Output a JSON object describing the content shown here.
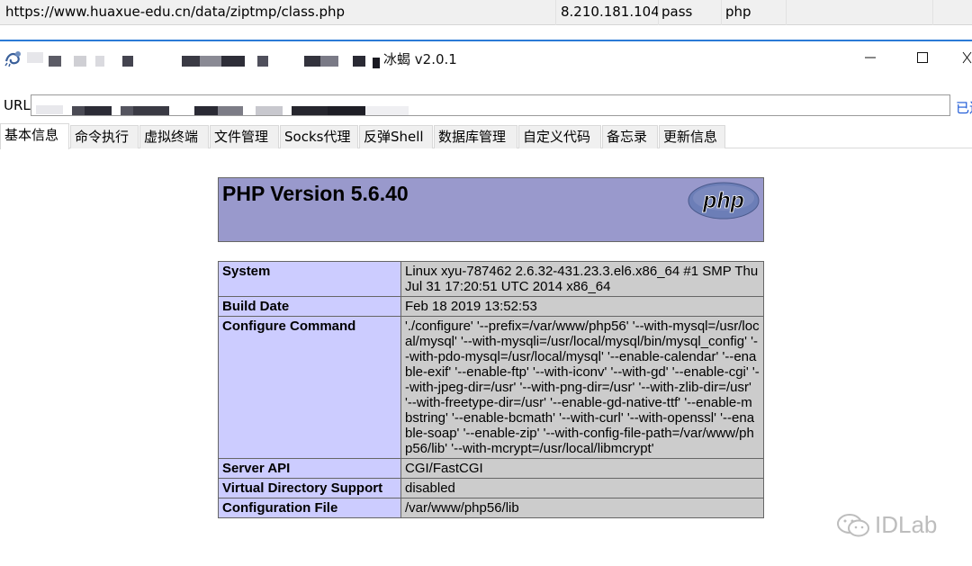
{
  "list_row": {
    "url": "https://www.huaxue-edu.cn/data/ziptmp/class.php",
    "ip": "8.210.181.104",
    "password": "pass",
    "type": "php"
  },
  "window": {
    "title": "冰蝎 v2.0.1"
  },
  "urlbar": {
    "label": "URL",
    "value": "",
    "status": "已连"
  },
  "tabs": [
    {
      "label": "基本信息"
    },
    {
      "label": "命令执行"
    },
    {
      "label": "虚拟终端"
    },
    {
      "label": "文件管理"
    },
    {
      "label": "Socks代理"
    },
    {
      "label": "反弹Shell"
    },
    {
      "label": "数据库管理"
    },
    {
      "label": "自定义代码"
    },
    {
      "label": "备忘录"
    },
    {
      "label": "更新信息"
    }
  ],
  "phpinfo": {
    "title": "PHP Version 5.6.40",
    "logo_text": "php",
    "rows": [
      {
        "key": "System",
        "value": "Linux xyu-787462 2.6.32-431.23.3.el6.x86_64 #1 SMP Thu Jul 31 17:20:51 UTC 2014 x86_64"
      },
      {
        "key": "Build Date",
        "value": "Feb 18 2019 13:52:53"
      },
      {
        "key": "Configure Command",
        "value": "'./configure' '--prefix=/var/www/php56' '--with-mysql=/usr/local/mysql' '--with-mysqli=/usr/local/mysql/bin/mysql_config' '--with-pdo-mysql=/usr/local/mysql' '--enable-calendar' '--enable-exif' '--enable-ftp' '--with-iconv' '--with-gd' '--enable-cgi' '--with-jpeg-dir=/usr' '--with-png-dir=/usr' '--with-zlib-dir=/usr' '--with-freetype-dir=/usr' '--enable-gd-native-ttf' '--enable-mbstring' '--enable-bcmath' '--with-curl' '--with-openssl' '--enable-soap' '--enable-zip' '--with-config-file-path=/var/www/php56/lib' '--with-mcrypt=/usr/local/libmcrypt'"
      },
      {
        "key": "Server API",
        "value": "CGI/FastCGI"
      },
      {
        "key": "Virtual Directory Support",
        "value": "disabled"
      },
      {
        "key": "Configuration File",
        "value": "/var/www/php56/lib"
      }
    ]
  },
  "watermark": {
    "text": "IDLab",
    "icon": "wechat-icon"
  },
  "colors": {
    "php_header": "#9999cc",
    "php_key": "#ccccff",
    "php_value": "#cccccc",
    "link_blue": "#1a57d6"
  }
}
